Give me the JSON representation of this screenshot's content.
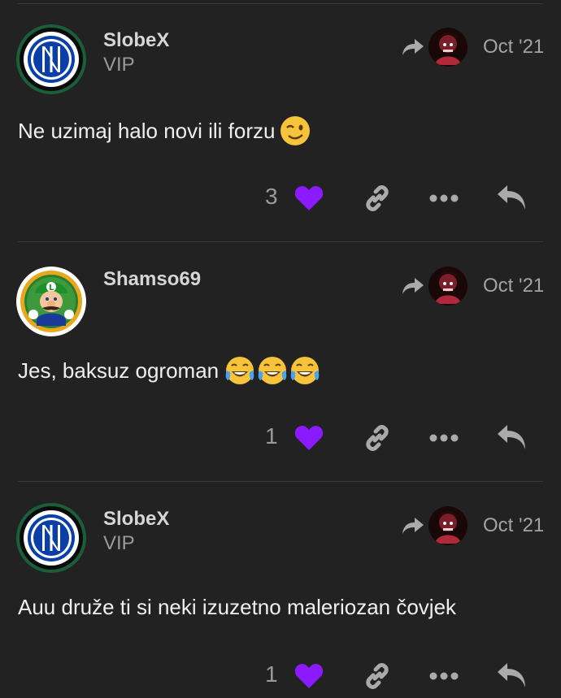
{
  "colors": {
    "background": "#222222",
    "heart": "#8b1aff",
    "muted": "#9a9a9a",
    "icon": "#aaaaaa"
  },
  "posts": [
    {
      "username": "SlobeX",
      "user_title": "VIP",
      "avatar": "inter-logo",
      "date": "Oct '21",
      "text": "Ne uzimaj halo novi ili forzu",
      "emojis": [
        "winking-face"
      ],
      "likes": "3"
    },
    {
      "username": "Shamso69",
      "user_title": "",
      "avatar": "luigi-coin",
      "date": "Oct '21",
      "text": "Jes, baksuz ogroman",
      "emojis": [
        "tears-of-joy",
        "tears-of-joy",
        "tears-of-joy"
      ],
      "likes": "1"
    },
    {
      "username": "SlobeX",
      "user_title": "VIP",
      "avatar": "inter-logo",
      "date": "Oct '21",
      "text": "Auu druže ti si neki izuzetno maleriozan čovjek",
      "emojis": [],
      "likes": "1"
    }
  ]
}
